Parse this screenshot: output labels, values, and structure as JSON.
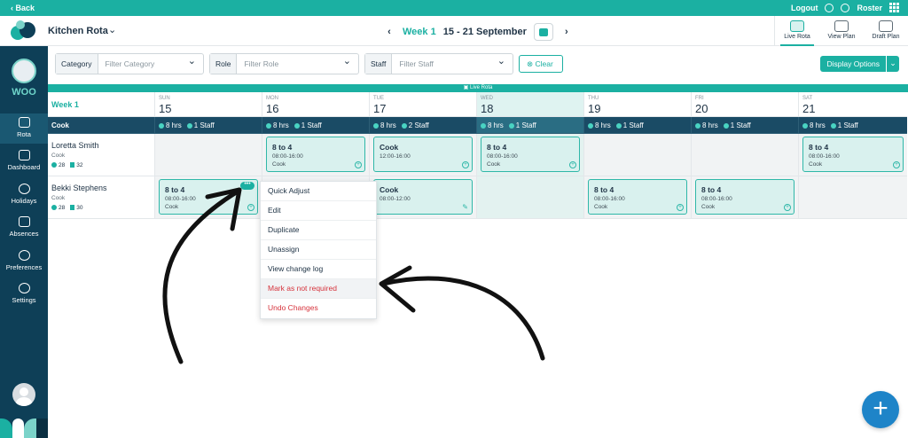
{
  "topbar": {
    "back": "‹ Back",
    "logout": "Logout",
    "roster": "Roster"
  },
  "header": {
    "title": "Kitchen Rota",
    "week_label": "Week 1",
    "date_range": "15 - 21 September",
    "view_tabs": [
      {
        "label": "Live Rota",
        "active": true
      },
      {
        "label": "View Plan",
        "active": false
      },
      {
        "label": "Draft Plan",
        "active": false
      }
    ]
  },
  "sidebar": {
    "brand": "WOO",
    "items": [
      {
        "label": "Rota",
        "icon": "calendar-icon",
        "active": true
      },
      {
        "label": "Dashboard",
        "icon": "dashboard-icon"
      },
      {
        "label": "Holidays",
        "icon": "plane-icon"
      },
      {
        "label": "Absences",
        "icon": "absences-icon"
      },
      {
        "label": "Preferences",
        "icon": "person-settings-icon"
      },
      {
        "label": "Settings",
        "icon": "gear-icon"
      }
    ]
  },
  "filters": {
    "category": {
      "label": "Category",
      "placeholder": "Filter Category"
    },
    "role": {
      "label": "Role",
      "placeholder": "Filter Role"
    },
    "staff": {
      "label": "Staff",
      "placeholder": "Filter Staff"
    },
    "clear": "Clear",
    "display_options": "Display Options"
  },
  "grid": {
    "banner": "Live Rota",
    "week_label": "Week 1",
    "days": [
      {
        "name": "SUN",
        "num": "15"
      },
      {
        "name": "MON",
        "num": "16"
      },
      {
        "name": "TUE",
        "num": "17"
      },
      {
        "name": "WED",
        "num": "18",
        "today": true
      },
      {
        "name": "THU",
        "num": "19"
      },
      {
        "name": "FRI",
        "num": "20"
      },
      {
        "name": "SAT",
        "num": "21"
      }
    ],
    "role": {
      "name": "Cook",
      "stats": [
        {
          "hrs": "8 hrs",
          "staff": "1 Staff"
        },
        {
          "hrs": "8 hrs",
          "staff": "1 Staff"
        },
        {
          "hrs": "8 hrs",
          "staff": "2 Staff"
        },
        {
          "hrs": "8 hrs",
          "staff": "1 Staff"
        },
        {
          "hrs": "8 hrs",
          "staff": "1 Staff"
        },
        {
          "hrs": "8 hrs",
          "staff": "1 Staff"
        },
        {
          "hrs": "8 hrs",
          "staff": "1 Staff"
        }
      ]
    },
    "staff": [
      {
        "name": "Loretta Smith",
        "role": "Cook",
        "days_stat": "28",
        "hours_stat": "32",
        "shifts": [
          null,
          {
            "title": "8 to 4",
            "time": "08:00-16:00",
            "role": "Cook"
          },
          {
            "title": "Cook",
            "time": "12:00-16:00",
            "role": ""
          },
          {
            "title": "8 to 4",
            "time": "08:00-16:00",
            "role": "Cook"
          },
          null,
          null,
          {
            "title": "8 to 4",
            "time": "08:00-16:00",
            "role": "Cook"
          }
        ]
      },
      {
        "name": "Bekki Stephens",
        "role": "Cook",
        "days_stat": "28",
        "hours_stat": "30",
        "shifts": [
          {
            "title": "8 to 4",
            "time": "08:00-16:00",
            "role": "Cook",
            "more": true
          },
          null,
          {
            "title": "Cook",
            "time": "08:00-12:00",
            "role": "",
            "edit": true
          },
          null,
          {
            "title": "8 to 4",
            "time": "08:00-16:00",
            "role": "Cook"
          },
          {
            "title": "8 to 4",
            "time": "08:00-16:00",
            "role": "Cook"
          },
          null
        ]
      }
    ]
  },
  "context_menu": {
    "items": [
      {
        "label": "Quick Adjust"
      },
      {
        "label": "Edit"
      },
      {
        "label": "Duplicate"
      },
      {
        "label": "Unassign"
      },
      {
        "label": "View change log"
      },
      {
        "label": "Mark as not required",
        "danger": true,
        "highlight": true
      },
      {
        "label": "Undo Changes",
        "danger": true
      }
    ]
  },
  "colors": {
    "accent": "#1bb0a2",
    "sidebar": "#0e3f57",
    "danger": "#d6333c",
    "fab": "#1e84c8"
  },
  "fab": "+"
}
